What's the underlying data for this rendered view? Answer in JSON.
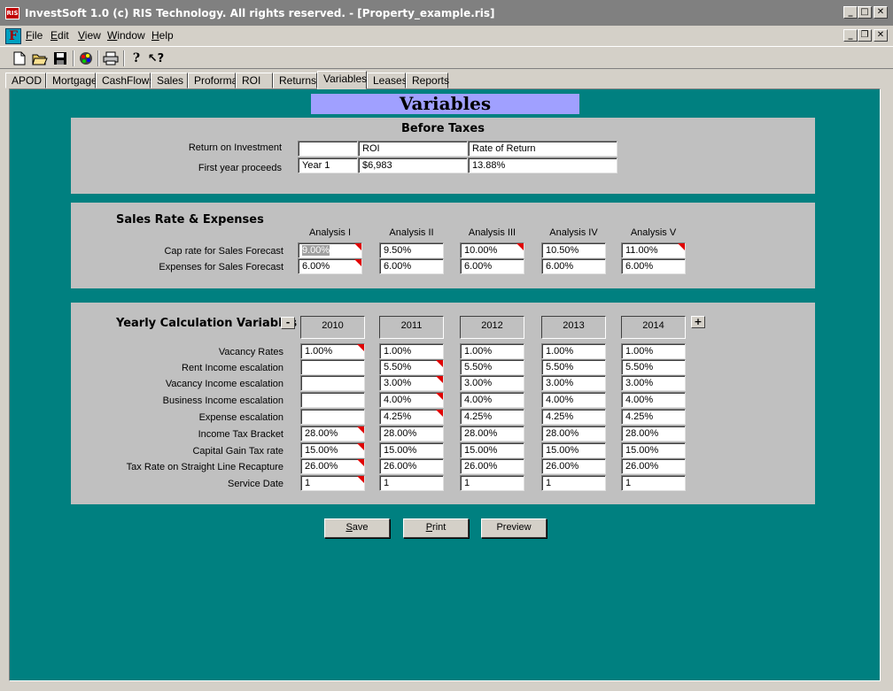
{
  "window": {
    "title": "InvestSoft 1.0 (c) RIS Technology. All rights reserved. - [Property_example.ris]",
    "app_icon": "RIS",
    "doc_icon": "F"
  },
  "menu": [
    {
      "label": "File",
      "ul": "F"
    },
    {
      "label": "Edit",
      "ul": "E"
    },
    {
      "label": "View",
      "ul": "V"
    },
    {
      "label": "Window",
      "ul": "W"
    },
    {
      "label": "Help",
      "ul": "H"
    }
  ],
  "toolbar": [
    "new-file-icon",
    "open-folder-icon",
    "save-disk-icon",
    "palette-icon",
    "print-icon",
    "help-icon",
    "context-help-icon"
  ],
  "tabs": [
    "APOD",
    "Mortgage",
    "CashFlows",
    "Sales",
    "Proforma",
    "ROI",
    "Returns",
    "Variables",
    "Leases",
    "Reports"
  ],
  "active_tab": "Variables",
  "page_title": "Variables",
  "before_taxes": {
    "title": "Before Taxes",
    "labels": [
      "Return on Investment",
      "First year proceeds"
    ],
    "header_row": [
      "",
      "ROI",
      "Rate of Return"
    ],
    "value_row": [
      "Year 1",
      "$6,983",
      "13.88%"
    ]
  },
  "sales": {
    "title": "Sales Rate & Expenses",
    "columns": [
      "Analysis I",
      "Analysis II",
      "Analysis III",
      "Analysis IV",
      "Analysis V"
    ],
    "rows": [
      {
        "label": "Cap rate for Sales Forecast",
        "values": [
          "9.00%",
          "9.50%",
          "10.00%",
          "10.50%",
          "11.00%"
        ]
      },
      {
        "label": "Expenses for Sales Forecast",
        "values": [
          "6.00%",
          "6.00%",
          "6.00%",
          "6.00%",
          "6.00%"
        ]
      }
    ]
  },
  "yearly": {
    "title": "Yearly Calculation Variables",
    "minus": "-",
    "plus": "+",
    "years": [
      "2010",
      "2011",
      "2012",
      "2013",
      "2014"
    ],
    "rows": [
      {
        "label": "Vacancy Rates",
        "values": [
          "1.00%",
          "1.00%",
          "1.00%",
          "1.00%",
          "1.00%"
        ]
      },
      {
        "label": "Rent Income escalation",
        "values": [
          "",
          "5.50%",
          "5.50%",
          "5.50%",
          "5.50%"
        ]
      },
      {
        "label": "Vacancy Income escalation",
        "values": [
          "",
          "3.00%",
          "3.00%",
          "3.00%",
          "3.00%"
        ]
      },
      {
        "label": "Business Income escalation",
        "values": [
          "",
          "4.00%",
          "4.00%",
          "4.00%",
          "4.00%"
        ]
      },
      {
        "label": "Expense escalation",
        "values": [
          "",
          "4.25%",
          "4.25%",
          "4.25%",
          "4.25%"
        ]
      },
      {
        "label": "Income Tax Bracket",
        "values": [
          "28.00%",
          "28.00%",
          "28.00%",
          "28.00%",
          "28.00%"
        ]
      },
      {
        "label": "Capital Gain Tax rate",
        "values": [
          "15.00%",
          "15.00%",
          "15.00%",
          "15.00%",
          "15.00%"
        ]
      },
      {
        "label": "Tax Rate on Straight Line Recapture",
        "values": [
          "26.00%",
          "26.00%",
          "26.00%",
          "26.00%",
          "26.00%"
        ]
      },
      {
        "label": "Service Date",
        "values": [
          "1",
          "1",
          "1",
          "1",
          "1"
        ]
      }
    ]
  },
  "buttons": [
    {
      "label": "Save",
      "ul": "S"
    },
    {
      "label": "Print",
      "ul": "P"
    },
    {
      "label": "Preview",
      "ul": ""
    }
  ],
  "colors": {
    "content_bg": "#008080",
    "title_bg": "#a0a0ff",
    "flag": "#e00000"
  }
}
